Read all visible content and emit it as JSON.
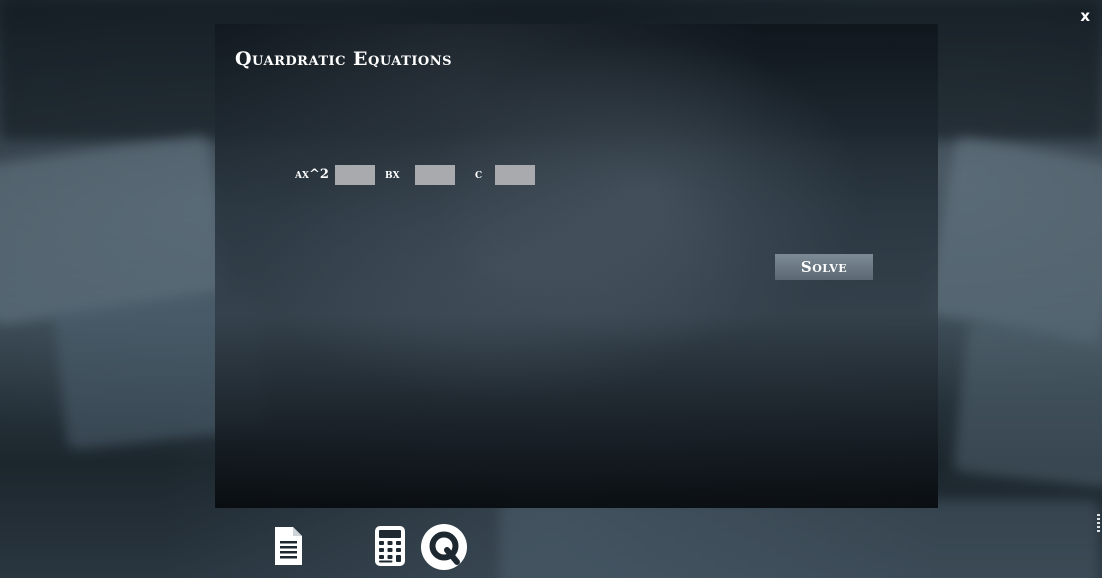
{
  "window": {
    "close_label": "x"
  },
  "panel": {
    "title": "Quardratic Equations",
    "coefficients": [
      {
        "label": "ax^2",
        "value": ""
      },
      {
        "label": "bx",
        "value": ""
      },
      {
        "label": "c",
        "value": ""
      }
    ],
    "solve_label": "Solve"
  },
  "taskbar": {
    "items": [
      {
        "icon": "document-icon"
      },
      {
        "icon": "calculator-icon"
      },
      {
        "icon": "q-logo-icon"
      }
    ]
  },
  "colors": {
    "input_bg": "#a8aaad",
    "button_bg": "#6f7d88",
    "text": "#ffffff"
  }
}
